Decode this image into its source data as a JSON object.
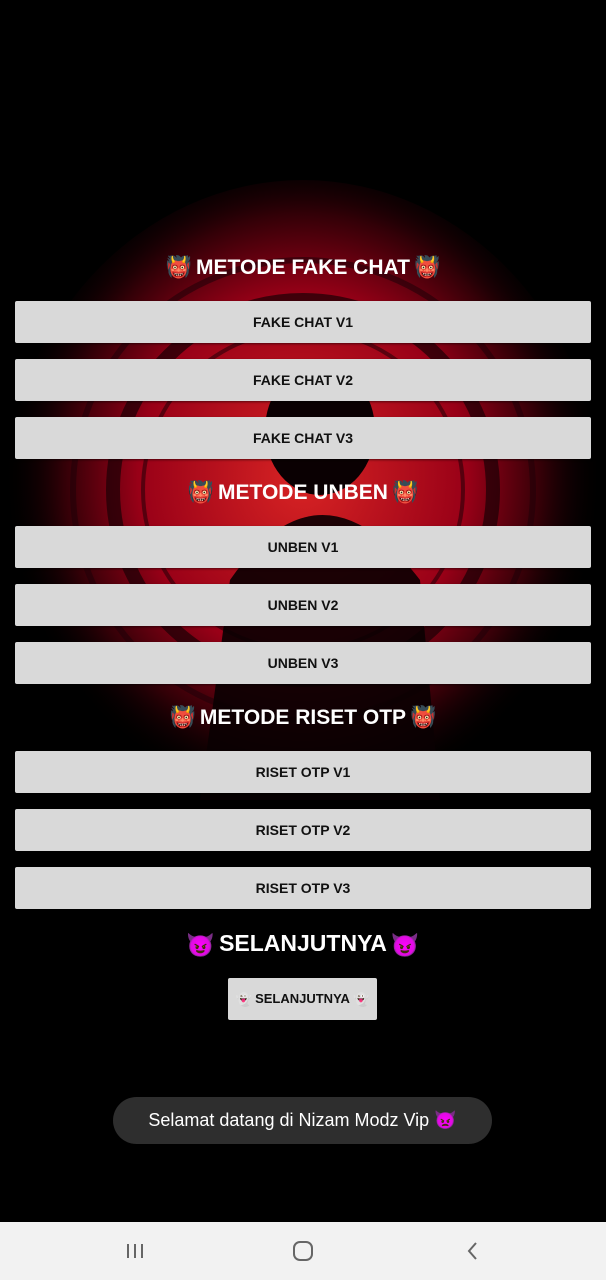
{
  "sections": [
    {
      "title": "METODE FAKE CHAT",
      "emoji": "👹",
      "buttons": [
        "FAKE CHAT V1",
        "FAKE CHAT V2",
        "FAKE CHAT V3"
      ]
    },
    {
      "title": "METODE UNBEN",
      "emoji": "👹",
      "buttons": [
        "UNBEN V1",
        "UNBEN V2",
        "UNBEN V3"
      ]
    },
    {
      "title": "METODE RISET OTP",
      "emoji": "👹",
      "buttons": [
        "RISET OTP V1",
        "RISET OTP V2",
        "RISET OTP V3"
      ]
    }
  ],
  "next": {
    "title": "SELANJUTNYA",
    "title_emoji": "😈",
    "button_label": "SELANJUTNYA",
    "button_emoji": "👻"
  },
  "toast": {
    "text": "Selamat datang di Nizam Modz Vip",
    "emoji": "👿"
  },
  "colors": {
    "background": "#000000",
    "button": "#d9d9d9",
    "button_text": "#111111",
    "title_text": "#ffffff",
    "art_red": "#d0121b",
    "toast_bg": "#2e2e2e",
    "navbar_bg": "#f2f2f2"
  },
  "navbar": {
    "icons": [
      "recent-apps-icon",
      "home-icon",
      "back-icon"
    ]
  }
}
